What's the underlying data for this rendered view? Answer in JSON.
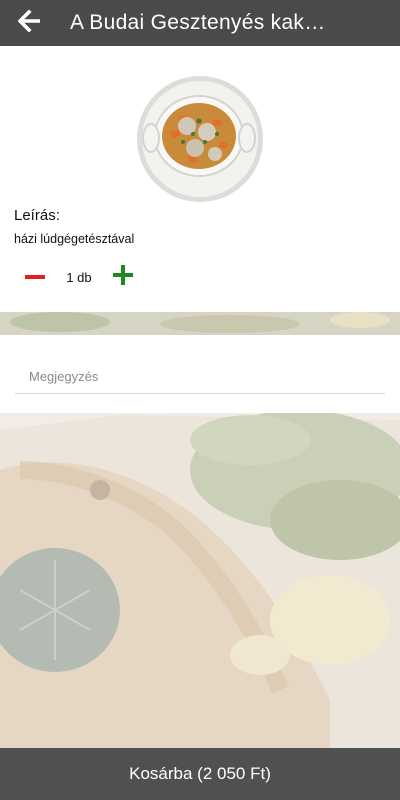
{
  "header": {
    "title": "A Budai Gesztenyés kak…",
    "back_icon": "arrow-left-icon"
  },
  "product": {
    "image_icon": "soup-bowl-image",
    "description_label": "Leírás:",
    "description": "házi lúdgégetésztával"
  },
  "quantity": {
    "minus_icon": "minus-icon",
    "plus_icon": "plus-icon",
    "value": "1 db",
    "minus_color": "#e0201b",
    "plus_color": "#1e8a1e"
  },
  "note": {
    "placeholder": "Megjegyzés",
    "value": ""
  },
  "footer": {
    "add_to_cart_label": "Kosárba (2 050 Ft)"
  },
  "colors": {
    "header_bg": "#4a4a4a",
    "footer_bg": "#505050"
  }
}
